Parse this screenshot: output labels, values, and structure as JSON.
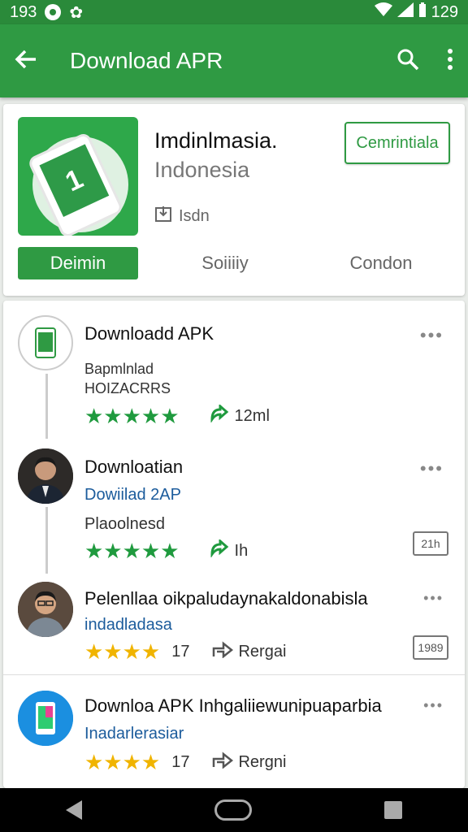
{
  "status_bar": {
    "time": "193",
    "battery_text": "129"
  },
  "app_bar": {
    "title": "Download APR",
    "back_icon": "back-arrow-icon",
    "search_icon": "search-icon",
    "more_icon": "more-vert-icon"
  },
  "header": {
    "app_name": "Imdinlmasia.",
    "app_subtitle": "Indonesia",
    "meta": "Isdn",
    "install_label": "Cemrintiala",
    "tabs": [
      {
        "label": "Deimin"
      },
      {
        "label": "Soiiiiy"
      },
      {
        "label": "Condon"
      }
    ]
  },
  "items": [
    {
      "title": "Downloadd APK",
      "sub": "Bapmlnlad",
      "sub2": "HOIZACRRS",
      "stars": "★★★★★",
      "meta_text": "12ml",
      "star_color": "green"
    },
    {
      "title": "Downloatian",
      "sub": "Dowiilad 2AP",
      "sub2": "Plaoolnesd",
      "stars": "★★★★★",
      "meta_text": "Ih",
      "badge": "21h",
      "star_color": "green"
    },
    {
      "title": "Pelenllaa oikpaludaynakaldonabisla",
      "sub": "indadladasa",
      "stars": "★★★★",
      "count": "17",
      "meta_text": "Rergai",
      "badge": "1989",
      "star_color": "gold"
    },
    {
      "title": "Downloa APK Inhgaliiewunipuaparbia",
      "sub": "Inadarlerasiar",
      "stars": "★★★★",
      "count": "17",
      "meta_text": "Rergni",
      "star_color": "gold"
    }
  ],
  "more_glyph": "•••",
  "colors": {
    "primary": "#2f9a43",
    "status": "#2a8a3a",
    "star_green": "#1f9a3e",
    "star_gold": "#f0b400",
    "link_blue": "#1c5c9c"
  }
}
